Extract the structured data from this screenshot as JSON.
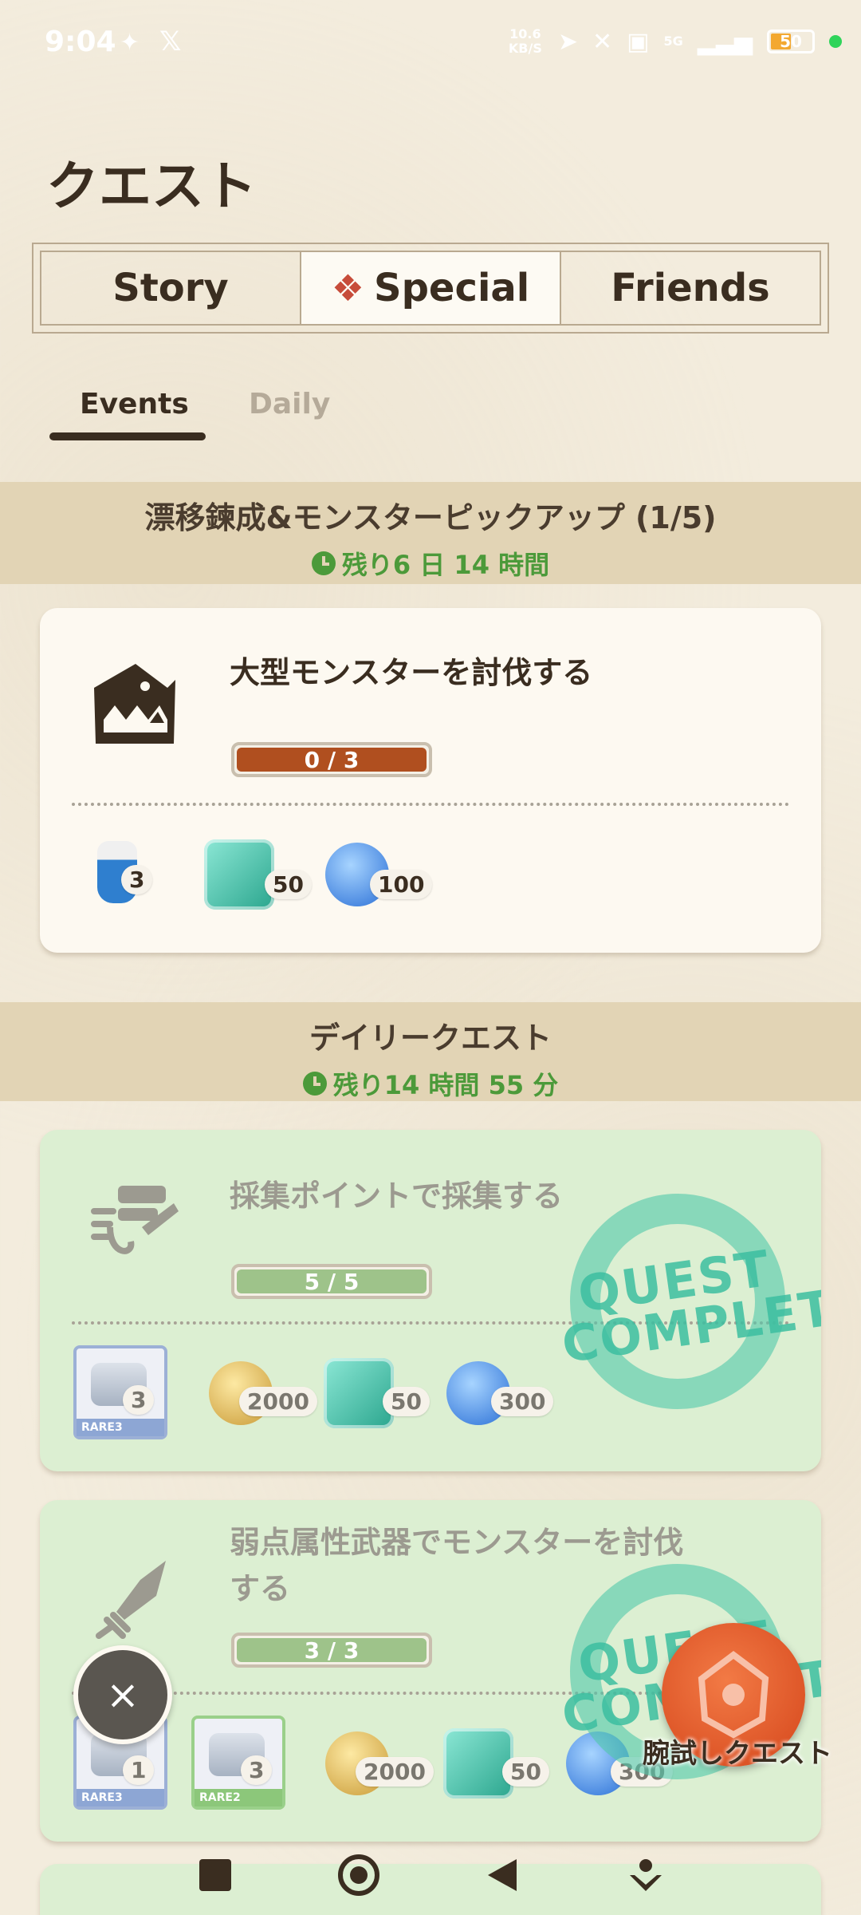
{
  "status_bar": {
    "time": "9:04",
    "net_speed": "10.6 KB/S",
    "network": "5G",
    "battery": "50"
  },
  "page": {
    "title": "クエスト"
  },
  "tabs": [
    {
      "label": "Story"
    },
    {
      "label": "Special"
    },
    {
      "label": "Friends"
    }
  ],
  "subtabs": [
    {
      "label": "Events"
    },
    {
      "label": "Daily"
    }
  ],
  "event_section": {
    "title": "漂移鍊成&モンスターピックアップ (1/5)",
    "time_left": "残り6 日 14 時間"
  },
  "event_quest": {
    "title": "大型モンスターを討伐する",
    "progress": "0 / 3",
    "progress_fraction": 0,
    "rewards": [
      {
        "icon": "potion-icon",
        "count": "3"
      },
      {
        "icon": "teal-gem-icon",
        "count": "50"
      },
      {
        "icon": "blue-orb-icon",
        "count": "100"
      }
    ]
  },
  "daily_section": {
    "title": "デイリークエスト",
    "time_left": "残り14 時間 55 分"
  },
  "daily_quests": [
    {
      "title": "採集ポイントで採集する",
      "progress": "5 / 5",
      "progress_fraction": 1,
      "stamp": "QUEST COMPLETED",
      "rewards": [
        {
          "icon": "material-icon",
          "count": "3",
          "rarity": "RARE3"
        },
        {
          "icon": "zenny-coin-icon",
          "count": "2000"
        },
        {
          "icon": "teal-gem-icon",
          "count": "50"
        },
        {
          "icon": "blue-orb-icon",
          "count": "300"
        }
      ]
    },
    {
      "title_line1": "弱点属性武器でモンスターを討伐",
      "title_line2": "する",
      "progress": "3 / 3",
      "progress_fraction": 1,
      "stamp": "QUEST COMPLETED",
      "rewards": [
        {
          "icon": "material-icon",
          "count": "1",
          "rarity": "RARE3"
        },
        {
          "icon": "material-icon",
          "count": "3",
          "rarity": "RARE2"
        },
        {
          "icon": "zenny-coin-icon",
          "count": "2000"
        },
        {
          "icon": "teal-gem-icon",
          "count": "50"
        },
        {
          "icon": "blue-orb-icon",
          "count": "300"
        }
      ]
    }
  ],
  "floating": {
    "close_symbol": "×",
    "quest_button_label": "腕試しクエスト"
  },
  "colors": {
    "background": "#f3ecdd",
    "section_header": "#e2d4b5",
    "time_green": "#4c9a3a",
    "progress_brown": "#b04f1f",
    "completed_card": "#dcefd2",
    "fab_orange": "#d5461b"
  }
}
